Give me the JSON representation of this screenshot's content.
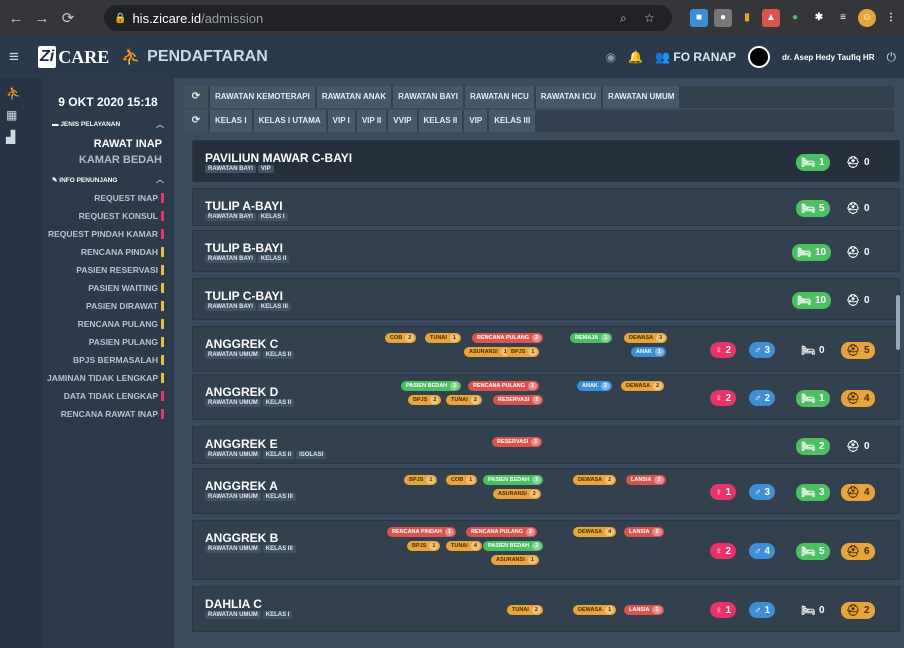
{
  "browser": {
    "url_host": "his.zicare.id",
    "url_path": "/admission"
  },
  "app": {
    "logo_box": "Zi",
    "logo_text": "CARE",
    "title": "PENDAFTARAN",
    "unit": "FO RANAP",
    "user": "dr. Asep Hedy Taufiq HR"
  },
  "sidebar": {
    "date": "9 OKT 2020 15:18",
    "jenis_header": "JENIS PELAYANAN",
    "active": "RAWAT INAP",
    "sub": "KAMAR BEDAH",
    "info_header": "INFO PENUNJANG",
    "items": [
      {
        "label": "REQUEST INAP",
        "color": "#e7326a"
      },
      {
        "label": "REQUEST KONSUL",
        "color": "#e7326a"
      },
      {
        "label": "REQUEST PINDAH KAMAR",
        "color": "#e7326a"
      },
      {
        "label": "RENCANA PINDAH",
        "color": "#e6c13b"
      },
      {
        "label": "PASIEN RESERVASI",
        "color": "#e6c13b"
      },
      {
        "label": "PASIEN WAITING",
        "color": "#e6c13b"
      },
      {
        "label": "PASIEN DIRAWAT",
        "color": "#e6c13b"
      },
      {
        "label": "RENCANA PULANG",
        "color": "#e6c13b"
      },
      {
        "label": "PASIEN PULANG",
        "color": "#e6c13b"
      },
      {
        "label": "BPJS BERMASALAH",
        "color": "#e6c13b"
      },
      {
        "label": "JAMINAN TIDAK LENGKAP",
        "color": "#e6c13b"
      },
      {
        "label": "DATA TIDAK LENGKAP",
        "color": "#e7326a"
      },
      {
        "label": "RENCANA RAWAT INAP",
        "color": "#e7326a"
      }
    ]
  },
  "tabs_row1": [
    "RAWATAN KEMOTERAPI",
    "RAWATAN ANAK",
    "RAWATAN BAYI",
    "RAWATAN HCU",
    "RAWATAN ICU",
    "RAWATAN UMUM"
  ],
  "tabs_row2": [
    "KELAS I",
    "KELAS I UTAMA",
    "VIP I",
    "VIP II",
    "VVIP",
    "KELAS II",
    "VIP",
    "KELAS III"
  ],
  "rooms": [
    {
      "name": "PAVILIUN MAWAR C-BAYI",
      "tags": [
        "RAWATAN BAYI",
        "VIP"
      ],
      "bed": "1",
      "bed_on": true,
      "amb": "0",
      "amb_on": false,
      "pills": [],
      "female": null,
      "male": null
    },
    {
      "name": "TULIP A-BAYI",
      "tags": [
        "RAWATAN BAYI",
        "KELAS I"
      ],
      "bed": "5",
      "bed_on": true,
      "amb": "0",
      "amb_on": false,
      "pills": [],
      "female": null,
      "male": null
    },
    {
      "name": "TULIP B-BAYI",
      "tags": [
        "RAWATAN BAYI",
        "KELAS II"
      ],
      "bed": "10",
      "bed_on": true,
      "amb": "0",
      "amb_on": false,
      "pills": [],
      "female": null,
      "male": null
    },
    {
      "name": "TULIP C-BAYI",
      "tags": [
        "RAWATAN BAYI",
        "KELAS III"
      ],
      "bed": "10",
      "bed_on": true,
      "amb": "0",
      "amb_on": false,
      "pills": [],
      "female": null,
      "male": null
    },
    {
      "name": "ANGGREK C",
      "tags": [
        "RAWATAN UMUM",
        "KELAS II"
      ],
      "bed": "0",
      "bed_on": false,
      "amb": "5",
      "amb_on": true,
      "female": "2",
      "male": "3",
      "pills": [
        {
          "t": "COB",
          "n": "2",
          "c": "o"
        },
        {
          "t": "TUNAI",
          "n": "1",
          "c": "o"
        },
        {
          "t": "RENCANA PULANG",
          "n": "2",
          "c": "r"
        },
        {
          "t": "ASURANSI",
          "n": "1",
          "c": "o"
        },
        {
          "t": "BPJS",
          "n": "1",
          "c": "o"
        },
        {
          "t": "REMAJA",
          "n": "1",
          "c": "g"
        },
        {
          "t": "DEWASA",
          "n": "3",
          "c": "o"
        },
        {
          "t": "ANAK",
          "n": "1",
          "c": "b"
        }
      ]
    },
    {
      "name": "ANGGREK D",
      "tags": [
        "RAWATAN UMUM",
        "KELAS II"
      ],
      "bed": "1",
      "bed_on": true,
      "amb": "4",
      "amb_on": true,
      "female": "2",
      "male": "2",
      "pills": [
        {
          "t": "PASIEN BEDAH",
          "n": "1",
          "c": "g"
        },
        {
          "t": "RENCANA PULANG",
          "n": "1",
          "c": "r"
        },
        {
          "t": "BPJS",
          "n": "2",
          "c": "o"
        },
        {
          "t": "TUNAI",
          "n": "2",
          "c": "o"
        },
        {
          "t": "RESERVASI",
          "n": "1",
          "c": "r"
        },
        {
          "t": "ANAK",
          "n": "2",
          "c": "b"
        },
        {
          "t": "DEWASA",
          "n": "2",
          "c": "o"
        }
      ]
    },
    {
      "name": "ANGGREK E",
      "tags": [
        "RAWATAN UMUM",
        "KELAS II",
        "ISOLASI"
      ],
      "bed": "2",
      "bed_on": true,
      "amb": "0",
      "amb_on": false,
      "female": null,
      "male": null,
      "pills": [
        {
          "t": "RESERVASI",
          "n": "1",
          "c": "r"
        }
      ]
    },
    {
      "name": "ANGGREK A",
      "tags": [
        "RAWATAN UMUM",
        "KELAS III"
      ],
      "bed": "3",
      "bed_on": true,
      "amb": "4",
      "amb_on": true,
      "female": "1",
      "male": "3",
      "pills": [
        {
          "t": "BPJS",
          "n": "1",
          "c": "o"
        },
        {
          "t": "COB",
          "n": "1",
          "c": "o"
        },
        {
          "t": "PASIEN BEDAH",
          "n": "1",
          "c": "g"
        },
        {
          "t": "ASURANSI",
          "n": "2",
          "c": "o"
        },
        {
          "t": "DEWASA",
          "n": "2",
          "c": "o"
        },
        {
          "t": "LANSIA",
          "n": "2",
          "c": "r"
        }
      ]
    },
    {
      "name": "ANGGREK B",
      "tags": [
        "RAWATAN UMUM",
        "KELAS III"
      ],
      "bed": "5",
      "bed_on": true,
      "amb": "6",
      "amb_on": true,
      "female": "2",
      "male": "4",
      "pills": [
        {
          "t": "RENCANA PINDAH",
          "n": "1",
          "c": "r"
        },
        {
          "t": "RENCANA PULANG",
          "n": "2",
          "c": "r"
        },
        {
          "t": "BPJS",
          "n": "1",
          "c": "o"
        },
        {
          "t": "TUNAI",
          "n": "4",
          "c": "o"
        },
        {
          "t": "PASIEN BEDAH",
          "n": "2",
          "c": "g"
        },
        {
          "t": "ASURANSI",
          "n": "1",
          "c": "o"
        },
        {
          "t": "DEWASA",
          "n": "4",
          "c": "o"
        },
        {
          "t": "LANSIA",
          "n": "2",
          "c": "r"
        }
      ]
    },
    {
      "name": "DAHLIA C",
      "tags": [
        "RAWATAN UMUM",
        "KELAS I"
      ],
      "bed": "0",
      "bed_on": false,
      "amb": "2",
      "amb_on": true,
      "female": "1",
      "male": "1",
      "pills": [
        {
          "t": "TUNAI",
          "n": "2",
          "c": "o"
        },
        {
          "t": "DEWASA",
          "n": "1",
          "c": "o"
        },
        {
          "t": "LANSIA",
          "n": "1",
          "c": "r"
        }
      ]
    }
  ]
}
